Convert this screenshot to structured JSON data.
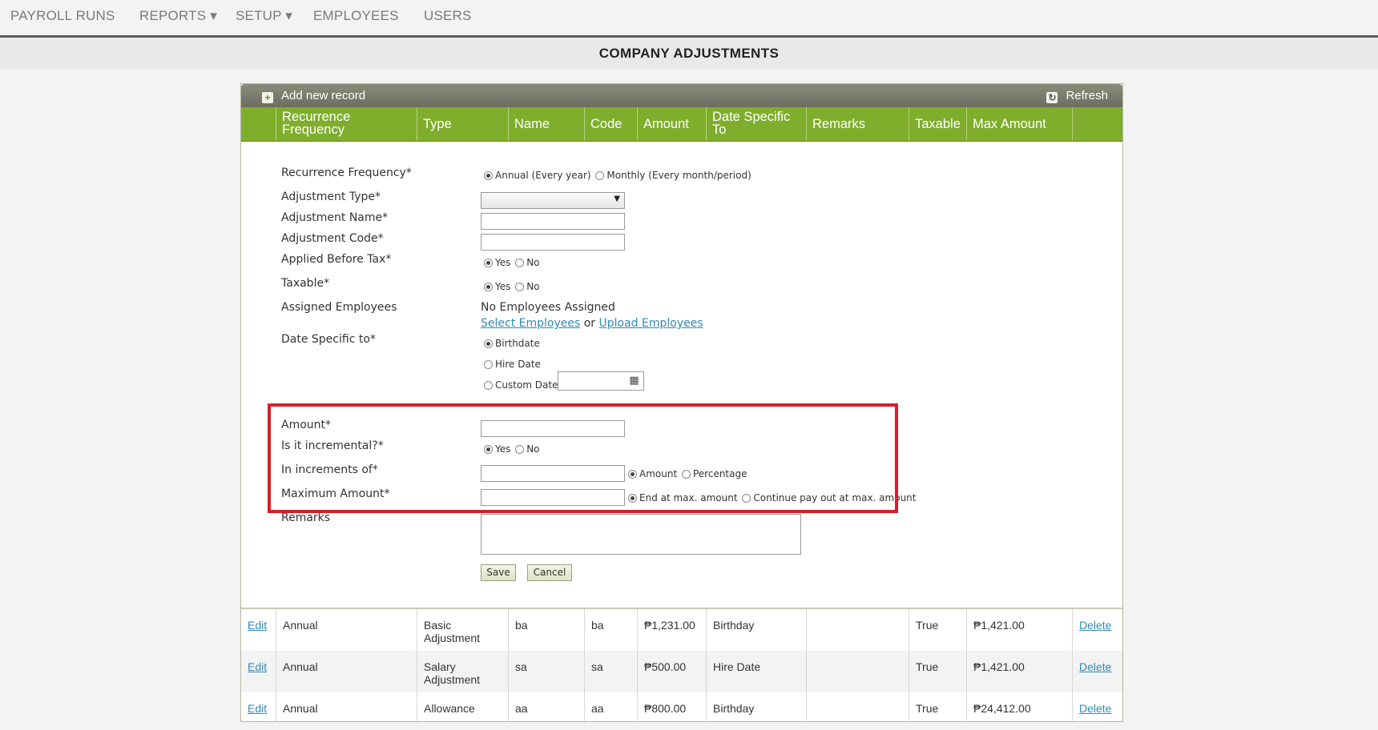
{
  "nav": {
    "payroll_runs": "PAYROLL RUNS",
    "reports": "REPORTS ▾",
    "setup": "SETUP ▾",
    "employees": "EMPLOYEES",
    "users": "USERS"
  },
  "page_title": "COMPANY ADJUSTMENTS",
  "toolbar": {
    "add": "Add new record",
    "refresh": "Refresh"
  },
  "columns": [
    "Recurrence Frequency",
    "Type",
    "Name",
    "Code",
    "Amount",
    "Date Specific To",
    "Remarks",
    "Taxable",
    "Max Amount"
  ],
  "form": {
    "recurrence_label": "Recurrence Frequency*",
    "recurrence_opt1": "Annual (Every year)",
    "recurrence_opt2": "Monthly (Every month/period)",
    "type_label": "Adjustment Type*",
    "name_label": "Adjustment Name*",
    "code_label": "Adjustment Code*",
    "before_tax_label": "Applied Before Tax*",
    "taxable_label": "Taxable*",
    "yes": "Yes",
    "no": "No",
    "assigned_label": "Assigned Employees",
    "assigned_value": "No Employees Assigned",
    "select_employees": "Select Employees",
    "or": "or",
    "upload_employees": "Upload Employees",
    "date_label": "Date Specific to*",
    "birthdate": "Birthdate",
    "hire_date": "Hire Date",
    "custom_date": "Custom Date",
    "amount_label": "Amount*",
    "incremental_label": "Is it incremental?*",
    "increments_label": "In increments of*",
    "inc_amount": "Amount",
    "inc_percentage": "Percentage",
    "max_label": "Maximum Amount*",
    "max_end": "End at max. amount",
    "max_continue": "Continue pay out at max. amount",
    "remarks_label": "Remarks",
    "save": "Save",
    "cancel": "Cancel"
  },
  "rows": [
    {
      "edit": "Edit",
      "freq": "Annual",
      "type1": "Basic",
      "type2": "Adjustment",
      "name": "ba",
      "code": "ba",
      "amount": "₱1,231.00",
      "date": "Birthday",
      "remarks": "",
      "taxable": "True",
      "max": "₱1,421.00",
      "delete": "Delete"
    },
    {
      "edit": "Edit",
      "freq": "Annual",
      "type1": "Salary",
      "type2": "Adjustment",
      "name": "sa",
      "code": "sa",
      "amount": "₱500.00",
      "date": "Hire Date",
      "remarks": "",
      "taxable": "True",
      "max": "₱1,421.00",
      "delete": "Delete"
    },
    {
      "edit": "Edit",
      "freq": "Annual",
      "type1": "Allowance",
      "type2": "",
      "name": "aa",
      "code": "aa",
      "amount": "₱800.00",
      "date": "Birthday",
      "remarks": "",
      "taxable": "True",
      "max": "₱24,412.00",
      "delete": "Delete"
    }
  ],
  "colors": {
    "header_green": "#7fae2c",
    "highlight_red": "#d4202a",
    "link_blue": "#2f8ab4"
  }
}
